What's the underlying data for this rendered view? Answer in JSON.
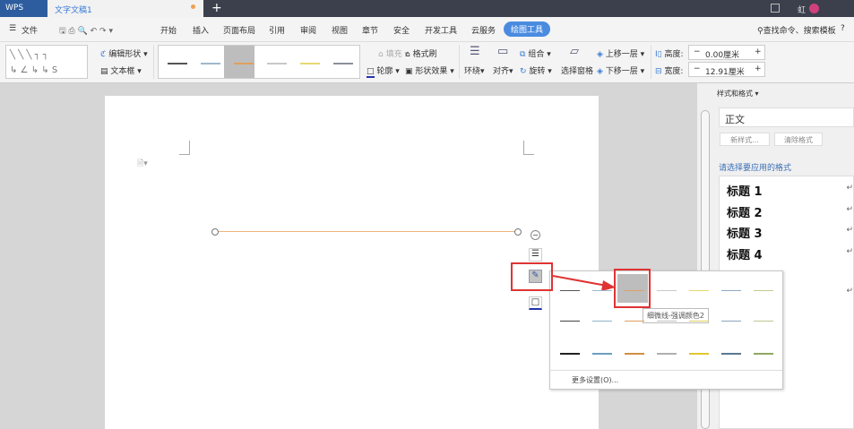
{
  "titlebar": {
    "app": "WPS",
    "doc_tab": "文字文稿1",
    "new_tab": "+",
    "user": "虹"
  },
  "menu": {
    "file": "文件",
    "items": [
      "开始",
      "插入",
      "页面布局",
      "引用",
      "审阅",
      "视图",
      "章节",
      "安全",
      "开发工具",
      "云服务",
      "绘图工具"
    ],
    "active": "绘图工具",
    "search": "查找命令、搜索模板",
    "help": "?"
  },
  "ribbon": {
    "edit_shape": "编辑形状",
    "textbox": "文本框",
    "fill": "填充",
    "format_painter": "格式刷",
    "outline": "轮廓",
    "shape_effect": "形状效果",
    "wrap": "环绕",
    "align": "对齐",
    "group": "组合",
    "rotate": "旋转",
    "selection_pane": "选择窗格",
    "bring_forward": "上移一层",
    "send_backward": "下移一层",
    "height_label": "高度:",
    "height_value": "0.00厘米",
    "width_label": "宽度:",
    "width_value": "12.91厘米",
    "line_styles": [
      "#555555",
      "#9fb8cc",
      "#e0a060",
      "#c8c8c8",
      "#e8d870",
      "#8a9099"
    ]
  },
  "panel": {
    "title": "样式和格式",
    "current_style": "正文",
    "new_style": "新样式...",
    "clear_format": "清除格式",
    "prompt": "请选择要应用的格式",
    "styles": [
      "标题 1",
      "标题 2",
      "标题 3",
      "标题 4"
    ]
  },
  "popup": {
    "rows": [
      [
        "#555555",
        "#9fb8cc",
        "#e0a060",
        "#c8c8c8",
        "#e8d870",
        "#8faac4",
        "#c4c890"
      ],
      [
        "#444444",
        "#90b4c8",
        "#e0a060",
        "#c0c0c0",
        "#e0d060",
        "#8aa4bc",
        "#c0c490"
      ],
      [
        "#222222",
        "#6a9fc0",
        "#d09040",
        "#b0b0b0",
        "#e0c830",
        "#5a7890",
        "#90a860"
      ]
    ],
    "tooltip": "细微线-强调颜色2",
    "more": "更多设置(O)..."
  },
  "colors": {
    "accent": "#4a8be0",
    "highlight": "#e03333",
    "shape_line": "#f0b37e"
  }
}
